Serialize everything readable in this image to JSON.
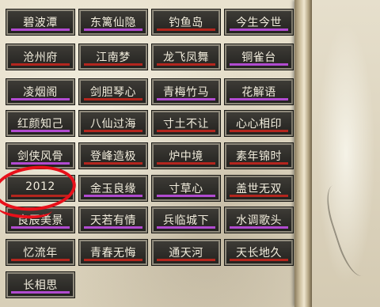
{
  "colors": {
    "purple": "#b14bd0",
    "red": "#b3261e",
    "annotation": "#e8101a"
  },
  "buttons": [
    {
      "label": "碧波潭",
      "bar": "purple"
    },
    {
      "label": "东篱仙隐",
      "bar": "purple"
    },
    {
      "label": "钓鱼岛",
      "bar": "red"
    },
    {
      "label": "今生今世",
      "bar": "purple"
    },
    {
      "label": "沧州府",
      "bar": "red"
    },
    {
      "label": "江南梦",
      "bar": "red"
    },
    {
      "label": "龙飞凤舞",
      "bar": "red"
    },
    {
      "label": "铜雀台",
      "bar": "purple"
    },
    {
      "label": "凌烟阁",
      "bar": "purple"
    },
    {
      "label": "剑胆琴心",
      "bar": "red"
    },
    {
      "label": "青梅竹马",
      "bar": "purple"
    },
    {
      "label": "花解语",
      "bar": "purple"
    },
    {
      "label": "红颜知己",
      "bar": "purple"
    },
    {
      "label": "八仙过海",
      "bar": "red"
    },
    {
      "label": "寸土不让",
      "bar": "red"
    },
    {
      "label": "心心相印",
      "bar": "red"
    },
    {
      "label": "剑侠风骨",
      "bar": "purple"
    },
    {
      "label": "登峰造极",
      "bar": "red"
    },
    {
      "label": "炉中境",
      "bar": "red"
    },
    {
      "label": "素年锦时",
      "bar": "red"
    },
    {
      "label": "2012",
      "bar": "red"
    },
    {
      "label": "金玉良缘",
      "bar": "purple"
    },
    {
      "label": "寸草心",
      "bar": "purple"
    },
    {
      "label": "盖世无双",
      "bar": "red"
    },
    {
      "label": "良辰美景",
      "bar": "purple"
    },
    {
      "label": "天若有情",
      "bar": "purple"
    },
    {
      "label": "兵临城下",
      "bar": "purple"
    },
    {
      "label": "水调歌头",
      "bar": "purple"
    },
    {
      "label": "忆流年",
      "bar": "red"
    },
    {
      "label": "青春无悔",
      "bar": "red"
    },
    {
      "label": "通天河",
      "bar": "red"
    },
    {
      "label": "天长地久",
      "bar": "red"
    },
    {
      "label": "长相思",
      "bar": "purple"
    }
  ]
}
